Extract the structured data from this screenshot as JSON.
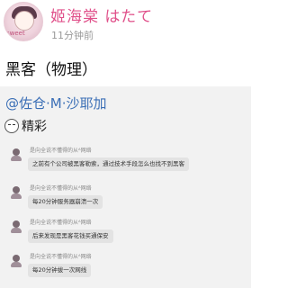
{
  "post": {
    "avatar_text": "sweet",
    "username": "姬海棠 はたて",
    "timestamp": "11分钟前",
    "title": "黑客（物理）"
  },
  "quote": {
    "mention": "@佐仓·M·沙耶加",
    "comment": "精彩"
  },
  "chat": [
    {
      "sender": "是向全说不懂得的从ᴬ网络",
      "text": "之前有个公司被黑客勒索，通过技术手段怎么也找不到黑客"
    },
    {
      "sender": "是向全说不懂得的从ᴬ网络",
      "text": "每20分钟服务器崩溃一次"
    },
    {
      "sender": "是向全说不懂得的从ᴬ网络",
      "text": "后来发现是黑客花钱买通保安"
    },
    {
      "sender": "是向全说不懂得的从ᴬ网络",
      "text": "每20分钟拔一次网线"
    }
  ]
}
